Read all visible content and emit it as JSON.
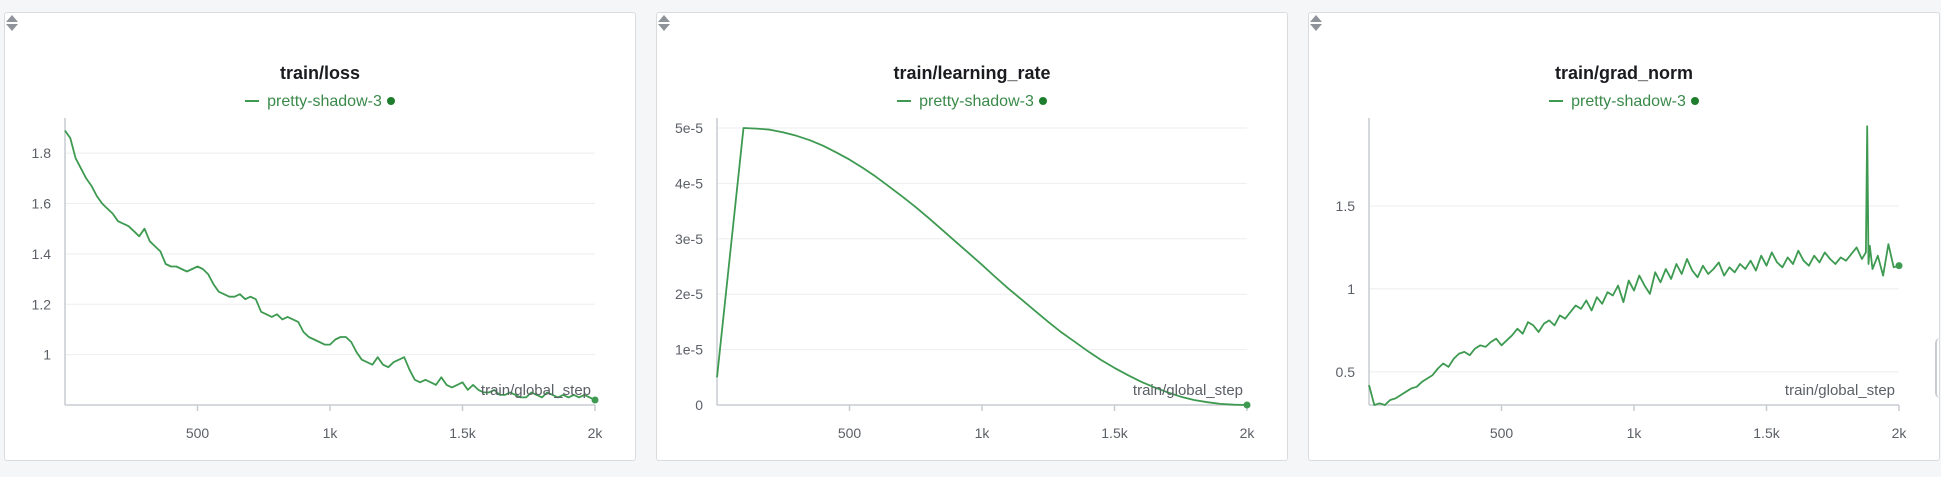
{
  "colors": {
    "series": "#3d9a50",
    "legend_text": "#3a8a4a",
    "legend_dot": "#1d7d2c",
    "grid": "#eceef0",
    "axis": "#c7cbd0"
  },
  "chart_data": [
    {
      "type": "line",
      "title": "train/loss",
      "xlabel": "train/global_step",
      "ylabel": "",
      "xlim": [
        0,
        2000
      ],
      "ylim": [
        0.8,
        1.9
      ],
      "x_ticks": [
        500,
        1000,
        1500,
        2000
      ],
      "x_tick_labels": [
        "500",
        "1k",
        "1.5k",
        "2k"
      ],
      "y_ticks": [
        1.0,
        1.2,
        1.4,
        1.6,
        1.8
      ],
      "y_tick_labels": [
        "1",
        "1.2",
        "1.4",
        "1.6",
        "1.8"
      ],
      "grid": true,
      "legend_position": "top-center",
      "series": [
        {
          "name": "pretty-shadow-3",
          "x": [
            0,
            20,
            40,
            60,
            80,
            100,
            120,
            140,
            160,
            180,
            200,
            220,
            240,
            260,
            280,
            300,
            320,
            340,
            360,
            380,
            400,
            420,
            440,
            460,
            480,
            500,
            520,
            540,
            560,
            580,
            600,
            620,
            640,
            660,
            680,
            700,
            720,
            740,
            760,
            780,
            800,
            820,
            840,
            860,
            880,
            900,
            920,
            940,
            960,
            980,
            1000,
            1020,
            1040,
            1060,
            1080,
            1100,
            1120,
            1140,
            1160,
            1180,
            1200,
            1220,
            1240,
            1260,
            1280,
            1300,
            1320,
            1340,
            1360,
            1380,
            1400,
            1420,
            1440,
            1460,
            1480,
            1500,
            1520,
            1540,
            1560,
            1580,
            1600,
            1620,
            1640,
            1660,
            1680,
            1700,
            1720,
            1740,
            1760,
            1780,
            1800,
            1820,
            1840,
            1860,
            1880,
            1900,
            1920,
            1940,
            1960,
            1980,
            2000
          ],
          "y": [
            1.89,
            1.86,
            1.78,
            1.74,
            1.7,
            1.67,
            1.63,
            1.6,
            1.58,
            1.56,
            1.53,
            1.52,
            1.51,
            1.49,
            1.47,
            1.5,
            1.45,
            1.43,
            1.41,
            1.36,
            1.35,
            1.35,
            1.34,
            1.33,
            1.34,
            1.35,
            1.34,
            1.32,
            1.28,
            1.25,
            1.24,
            1.23,
            1.23,
            1.24,
            1.22,
            1.23,
            1.22,
            1.17,
            1.16,
            1.15,
            1.16,
            1.14,
            1.15,
            1.14,
            1.13,
            1.09,
            1.07,
            1.06,
            1.05,
            1.04,
            1.04,
            1.06,
            1.07,
            1.07,
            1.05,
            1.01,
            0.98,
            0.97,
            0.96,
            0.99,
            0.96,
            0.95,
            0.97,
            0.98,
            0.99,
            0.94,
            0.9,
            0.89,
            0.9,
            0.89,
            0.88,
            0.91,
            0.88,
            0.87,
            0.88,
            0.89,
            0.86,
            0.88,
            0.86,
            0.85,
            0.85,
            0.86,
            0.84,
            0.84,
            0.85,
            0.84,
            0.83,
            0.83,
            0.85,
            0.84,
            0.83,
            0.85,
            0.84,
            0.83,
            0.84,
            0.83,
            0.84,
            0.83,
            0.84,
            0.83,
            0.82
          ]
        }
      ]
    },
    {
      "type": "line",
      "title": "train/learning_rate",
      "xlabel": "train/global_step",
      "ylabel": "",
      "xlim": [
        0,
        2000
      ],
      "ylim": [
        0,
        5e-05
      ],
      "x_ticks": [
        500,
        1000,
        1500,
        2000
      ],
      "x_tick_labels": [
        "500",
        "1k",
        "1.5k",
        "2k"
      ],
      "y_ticks": [
        0,
        1e-05,
        2e-05,
        3e-05,
        4e-05,
        5e-05
      ],
      "y_tick_labels": [
        "0",
        "1e-5",
        "2e-5",
        "3e-5",
        "4e-5",
        "5e-5"
      ],
      "grid": true,
      "legend_position": "top-center",
      "series": [
        {
          "name": "pretty-shadow-3",
          "x": [
            0,
            100,
            150,
            200,
            250,
            300,
            350,
            400,
            450,
            500,
            550,
            600,
            650,
            700,
            750,
            800,
            850,
            900,
            950,
            1000,
            1050,
            1100,
            1150,
            1200,
            1250,
            1300,
            1350,
            1400,
            1450,
            1500,
            1550,
            1600,
            1650,
            1700,
            1750,
            1800,
            1850,
            1900,
            1950,
            2000
          ],
          "y": [
            5e-06,
            5e-05,
            4.99e-05,
            4.97e-05,
            4.92e-05,
            4.86e-05,
            4.78e-05,
            4.68e-05,
            4.56e-05,
            4.43e-05,
            4.28e-05,
            4.12e-05,
            3.94e-05,
            3.76e-05,
            3.57e-05,
            3.37e-05,
            3.16e-05,
            2.95e-05,
            2.74e-05,
            2.53e-05,
            2.31e-05,
            2.1e-05,
            1.9e-05,
            1.7e-05,
            1.5e-05,
            1.31e-05,
            1.14e-05,
            9.7e-06,
            8.1e-06,
            6.7e-06,
            5.4e-06,
            4.2e-06,
            3.2e-06,
            2.3e-06,
            1.5e-06,
            9e-07,
            5e-07,
            2e-07,
            5e-08,
            0
          ]
        }
      ]
    },
    {
      "type": "line",
      "title": "train/grad_norm",
      "xlabel": "train/global_step",
      "ylabel": "",
      "xlim": [
        0,
        2000
      ],
      "ylim": [
        0.3,
        1.97
      ],
      "x_ticks": [
        500,
        1000,
        1500,
        2000
      ],
      "x_tick_labels": [
        "500",
        "1k",
        "1.5k",
        "2k"
      ],
      "y_ticks": [
        0.5,
        1.0,
        1.5
      ],
      "y_tick_labels": [
        "0.5",
        "1",
        "1.5"
      ],
      "grid": true,
      "legend_position": "top-center",
      "series": [
        {
          "name": "pretty-shadow-3",
          "x": [
            0,
            20,
            40,
            60,
            80,
            100,
            120,
            140,
            160,
            180,
            200,
            220,
            240,
            260,
            280,
            300,
            320,
            340,
            360,
            380,
            400,
            420,
            440,
            460,
            480,
            500,
            520,
            540,
            560,
            580,
            600,
            620,
            640,
            660,
            680,
            700,
            720,
            740,
            760,
            780,
            800,
            820,
            840,
            860,
            880,
            900,
            920,
            940,
            960,
            980,
            1000,
            1020,
            1040,
            1060,
            1080,
            1100,
            1120,
            1140,
            1160,
            1180,
            1200,
            1220,
            1240,
            1260,
            1280,
            1300,
            1320,
            1340,
            1360,
            1380,
            1400,
            1420,
            1440,
            1460,
            1480,
            1500,
            1520,
            1540,
            1560,
            1580,
            1600,
            1620,
            1640,
            1660,
            1680,
            1700,
            1720,
            1740,
            1760,
            1780,
            1800,
            1820,
            1840,
            1860,
            1875,
            1880,
            1885,
            1890,
            1900,
            1920,
            1940,
            1960,
            1980,
            2000
          ],
          "y": [
            0.42,
            0.3,
            0.31,
            0.3,
            0.33,
            0.34,
            0.36,
            0.38,
            0.4,
            0.41,
            0.44,
            0.46,
            0.48,
            0.52,
            0.55,
            0.53,
            0.58,
            0.61,
            0.62,
            0.6,
            0.64,
            0.66,
            0.65,
            0.68,
            0.7,
            0.66,
            0.69,
            0.72,
            0.76,
            0.73,
            0.8,
            0.78,
            0.74,
            0.79,
            0.81,
            0.78,
            0.84,
            0.82,
            0.86,
            0.9,
            0.88,
            0.93,
            0.87,
            0.95,
            0.91,
            0.98,
            0.96,
            1.02,
            0.92,
            1.05,
            0.99,
            1.08,
            1.02,
            0.97,
            1.1,
            1.04,
            1.12,
            1.06,
            1.15,
            1.09,
            1.18,
            1.11,
            1.07,
            1.14,
            1.09,
            1.12,
            1.16,
            1.08,
            1.13,
            1.1,
            1.15,
            1.12,
            1.17,
            1.11,
            1.2,
            1.14,
            1.22,
            1.16,
            1.13,
            1.19,
            1.15,
            1.23,
            1.17,
            1.14,
            1.2,
            1.16,
            1.22,
            1.18,
            1.15,
            1.19,
            1.17,
            1.21,
            1.25,
            1.18,
            1.22,
            1.98,
            1.15,
            1.26,
            1.12,
            1.2,
            1.08,
            1.27,
            1.13,
            1.14
          ]
        }
      ]
    }
  ]
}
